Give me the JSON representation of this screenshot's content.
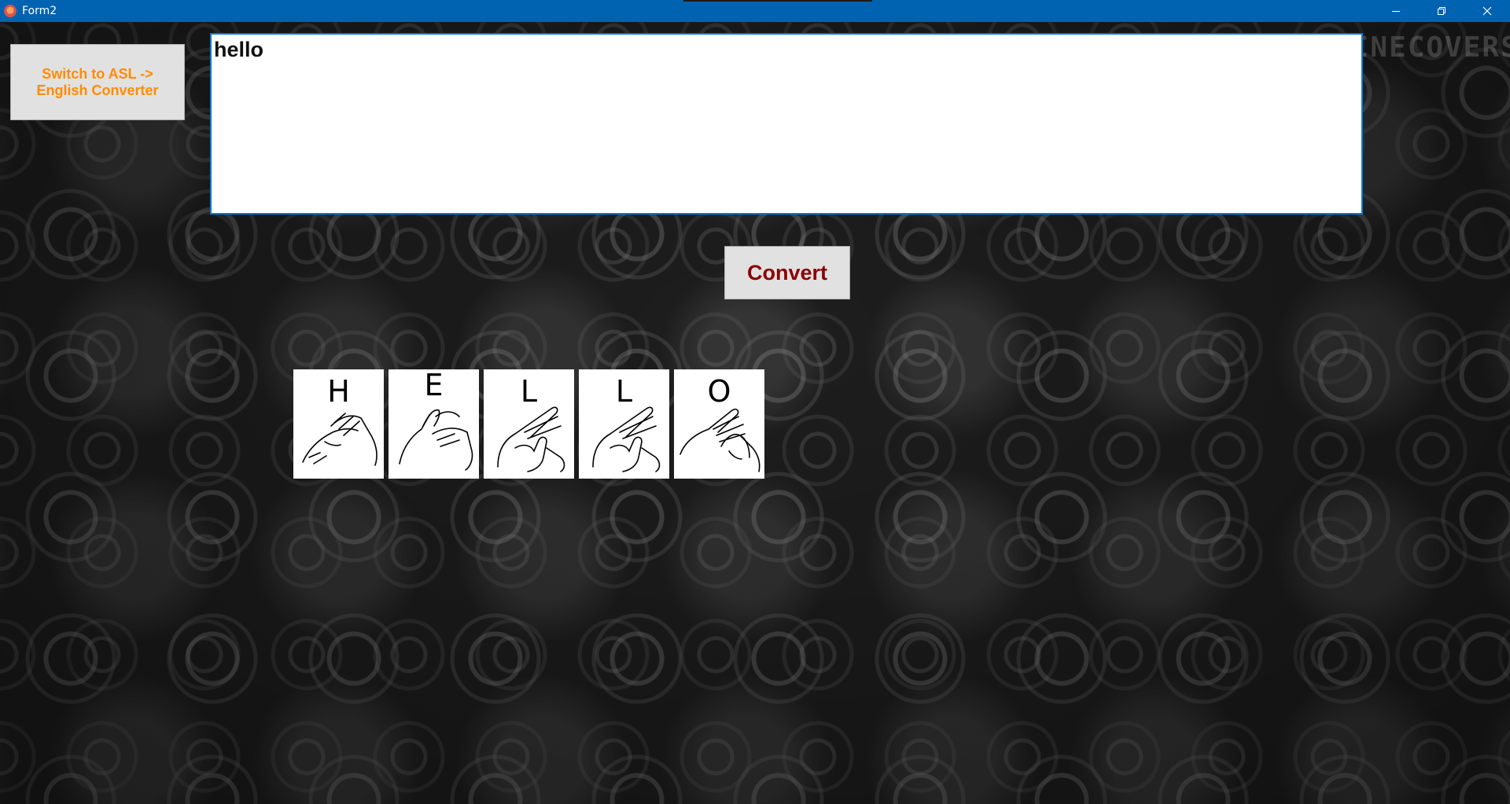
{
  "window": {
    "title": "Form2",
    "controls": [
      "minimize-icon",
      "restore-icon",
      "close-icon"
    ]
  },
  "watermark": "LINECOVERS.PRO",
  "switch_button": {
    "label": "Switch to ASL ->\nEnglish Converter",
    "color": "#ff8c00"
  },
  "text_input": {
    "value": "hello"
  },
  "convert_button": {
    "label": "Convert",
    "color": "#8b0000"
  },
  "signs": [
    {
      "letter": "H"
    },
    {
      "letter": "E"
    },
    {
      "letter": "L"
    },
    {
      "letter": "L"
    },
    {
      "letter": "O"
    }
  ]
}
